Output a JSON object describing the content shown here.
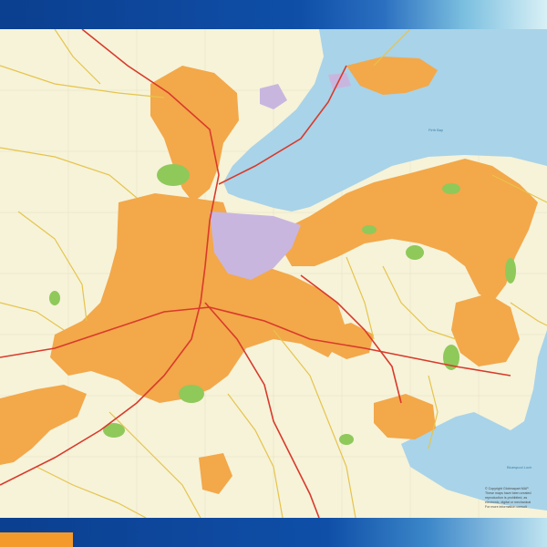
{
  "header": {
    "title": ""
  },
  "map": {
    "colors": {
      "land": "#f6f3d9",
      "water": "#a9d3e8",
      "urban": "#f3a84a",
      "park": "#8fc95a",
      "road_major": "#d93a2b",
      "road_minor": "#e6c44b",
      "industrial": "#c9b6df"
    },
    "water_labels": {
      "firth": "Firth Bay",
      "inlet": "Bluespool Loch"
    }
  },
  "footer": {
    "copyright": [
      "© Copyright Globmapart MAP",
      "These maps have been created",
      "reproduction is prohibited, as",
      "electronic, digital or mechanical",
      "For more information consult"
    ]
  }
}
